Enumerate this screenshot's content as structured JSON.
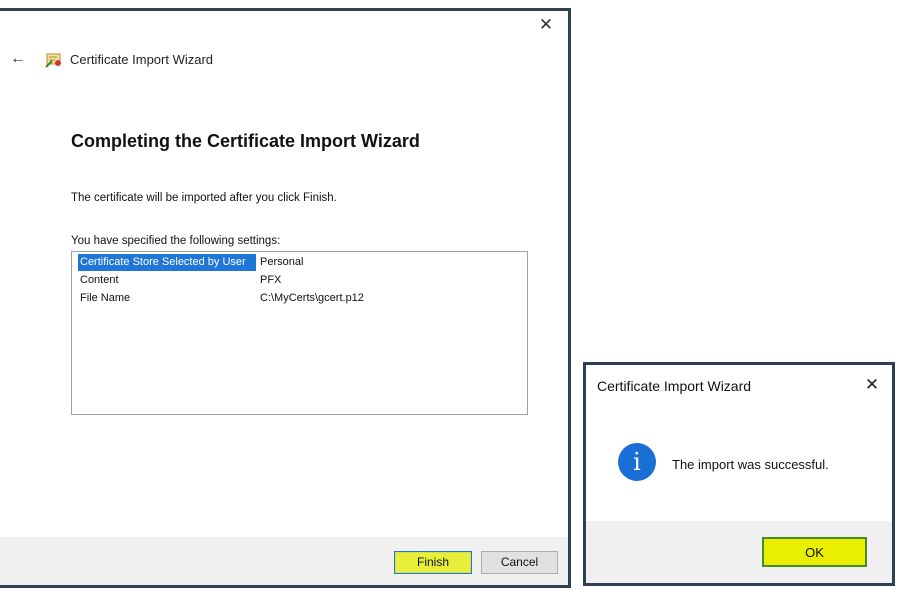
{
  "wizard": {
    "title": "Certificate Import Wizard",
    "close_glyph": "✕",
    "back_glyph": "←",
    "heading": "Completing the Certificate Import Wizard",
    "info_text": "The certificate will be imported after you click Finish.",
    "settings_label": "You have specified the following settings:",
    "settings": [
      {
        "key": "Certificate Store Selected by User",
        "value": "Personal"
      },
      {
        "key": "Content",
        "value": "PFX"
      },
      {
        "key": "File Name",
        "value": "C:\\MyCerts\\gcert.p12"
      }
    ],
    "finish_label": "Finish",
    "cancel_label": "Cancel"
  },
  "dialog": {
    "title": "Certificate Import Wizard",
    "close_glyph": "✕",
    "icon_glyph": "i",
    "message": "The import was successful.",
    "ok_label": "OK"
  },
  "colors": {
    "highlight": "#e8ef00",
    "selection": "#1f76d6",
    "frame": "#2f3f55",
    "info_icon": "#1a6fd6"
  }
}
